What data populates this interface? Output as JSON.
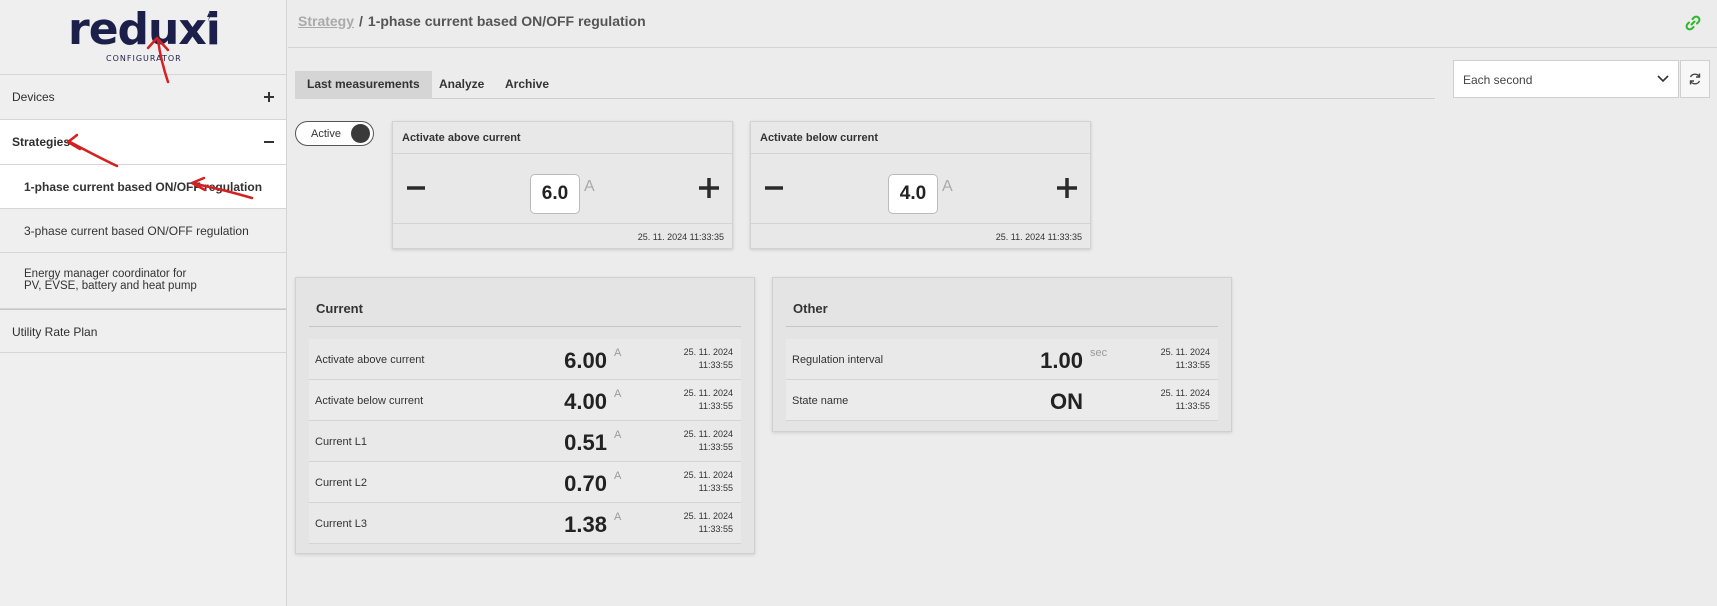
{
  "logo": {
    "word": "reduxi",
    "subtitle": "CONFIGURATOR"
  },
  "sidebar": {
    "devices_label": "Devices",
    "strategies_label": "Strategies",
    "strategies_children": [
      {
        "label": "1-phase current based ON/OFF regulation",
        "active": true
      },
      {
        "label": "3-phase current based ON/OFF regulation",
        "active": false
      },
      {
        "label": "Energy manager coordinator for\nPV, EVSE, battery and heat pump",
        "active": false
      }
    ],
    "utility_label": "Utility Rate Plan"
  },
  "header": {
    "breadcrumb_link": "Strategy",
    "breadcrumb_sep": "/",
    "breadcrumb_current": "1-phase current based ON/OFF regulation"
  },
  "tabs": [
    "Last measurements",
    "Analyze",
    "Archive"
  ],
  "active_tab": "Last measurements",
  "interval_select": {
    "value": "Each second"
  },
  "toggle": {
    "label": "Active",
    "on": true
  },
  "setpoints": [
    {
      "title": "Activate above current",
      "value": "6.0",
      "unit": "A",
      "timestamp": "25. 11. 2024 11:33:35"
    },
    {
      "title": "Activate below current",
      "value": "4.0",
      "unit": "A",
      "timestamp": "25. 11. 2024 11:33:35"
    }
  ],
  "panels": [
    {
      "title": "Current",
      "rows": [
        {
          "label": "Activate above current",
          "value": "6.00",
          "unit": "A",
          "timestamp": "25. 11. 2024\n11:33:55"
        },
        {
          "label": "Activate below current",
          "value": "4.00",
          "unit": "A",
          "timestamp": "25. 11. 2024\n11:33:55"
        },
        {
          "label": "Current L1",
          "value": "0.51",
          "unit": "A",
          "timestamp": "25. 11. 2024\n11:33:55"
        },
        {
          "label": "Current L2",
          "value": "0.70",
          "unit": "A",
          "timestamp": "25. 11. 2024\n11:33:55"
        },
        {
          "label": "Current L3",
          "value": "1.38",
          "unit": "A",
          "timestamp": "25. 11. 2024\n11:33:55"
        }
      ]
    },
    {
      "title": "Other",
      "rows": [
        {
          "label": "Regulation interval",
          "value": "1.00",
          "unit": "sec",
          "timestamp": "25. 11. 2024\n11:33:55"
        },
        {
          "label": "State name",
          "value": "ON",
          "unit": "",
          "timestamp": "25. 11. 2024\n11:33:55"
        }
      ]
    }
  ],
  "colors": {
    "link_icon": "#2db82d",
    "annotation": "#d42020",
    "logo": "#1b1f4a"
  },
  "icons": {
    "link": "link-icon",
    "refresh": "refresh-icon",
    "chevron": "chevron-down-icon"
  }
}
